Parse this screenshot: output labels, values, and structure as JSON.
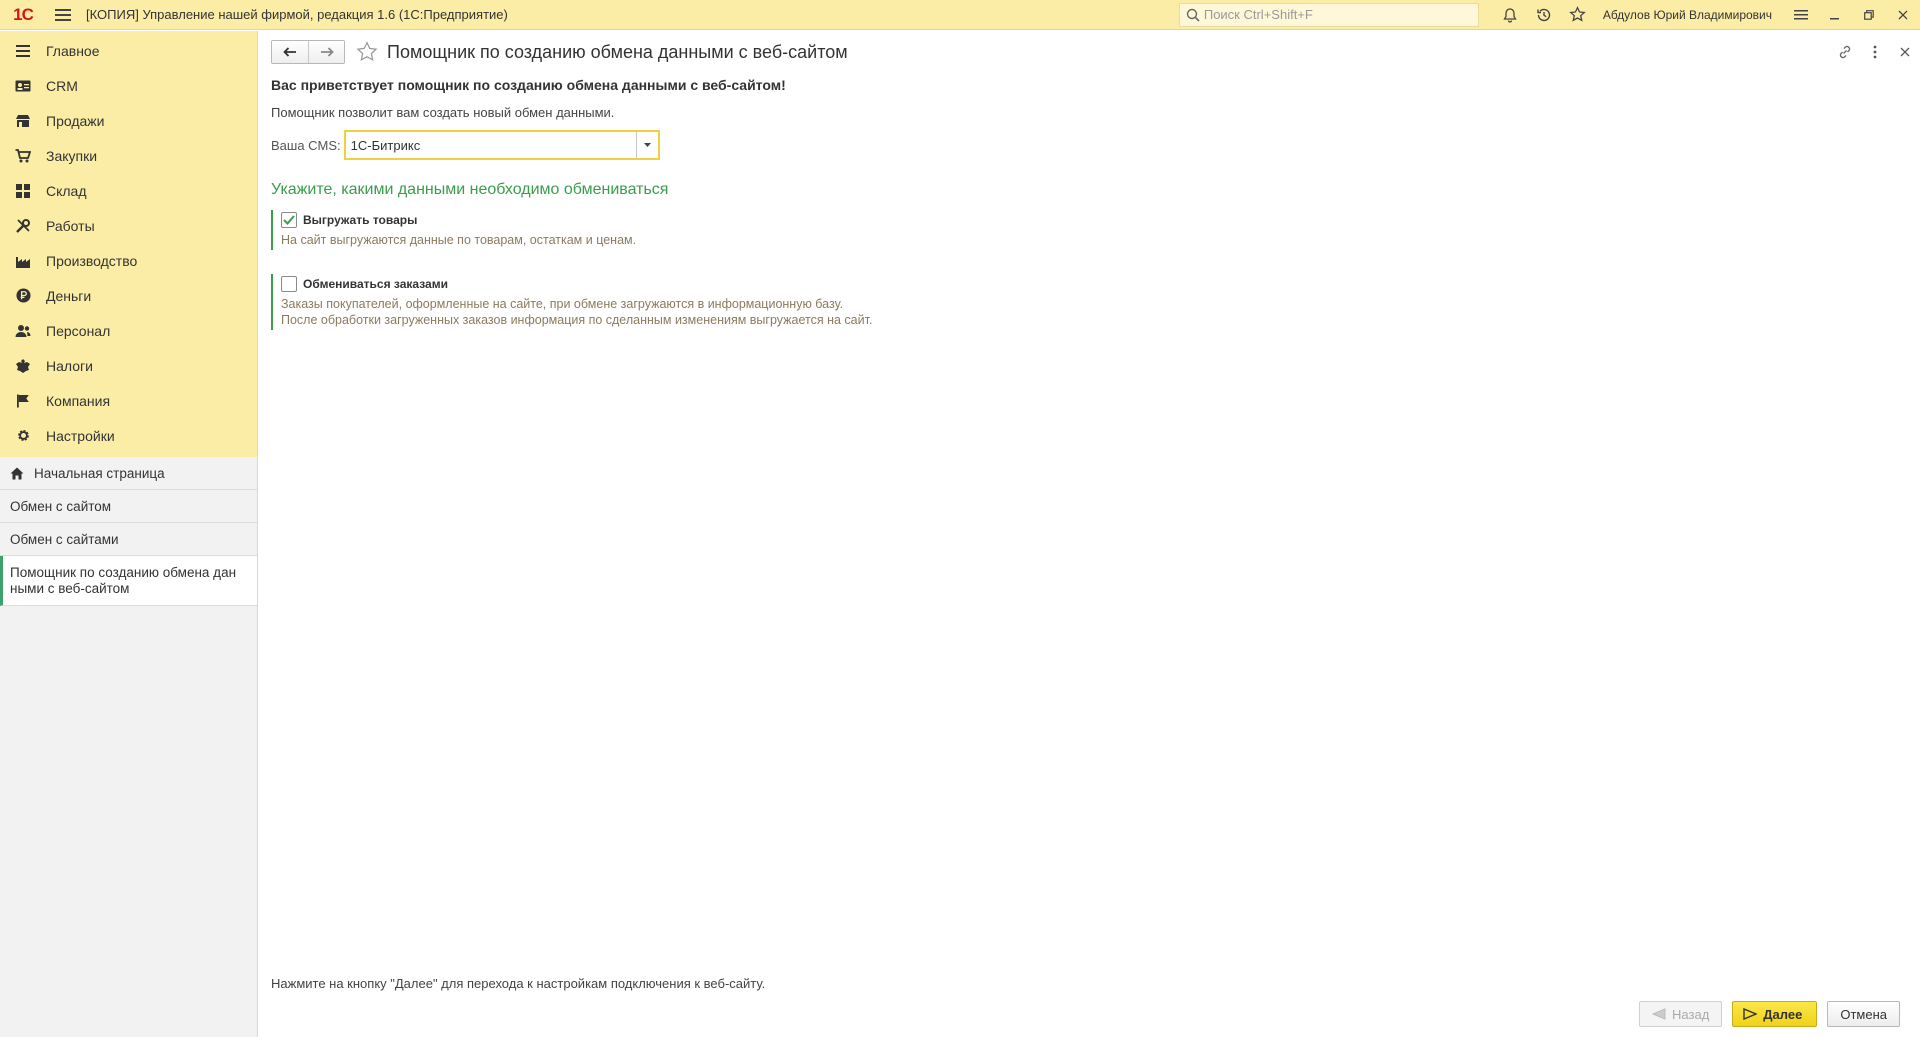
{
  "titlebar": {
    "logo": "1С",
    "title": "[КОПИЯ] Управление нашей фирмой, редакция 1.6  (1С:Предприятие)",
    "search_placeholder": "Поиск Ctrl+Shift+F",
    "user": "Абдулов Юрий Владимирович"
  },
  "sidebar": {
    "sections": [
      {
        "label": "Главное",
        "icon": "list-icon"
      },
      {
        "label": "CRM",
        "icon": "contacts-icon"
      },
      {
        "label": "Продажи",
        "icon": "shop-icon"
      },
      {
        "label": "Закупки",
        "icon": "cart-icon"
      },
      {
        "label": "Склад",
        "icon": "warehouse-icon"
      },
      {
        "label": "Работы",
        "icon": "tools-icon"
      },
      {
        "label": "Производство",
        "icon": "factory-icon"
      },
      {
        "label": "Деньги",
        "icon": "ruble-icon"
      },
      {
        "label": "Персонал",
        "icon": "people-icon"
      },
      {
        "label": "Налоги",
        "icon": "emblem-icon"
      },
      {
        "label": "Компания",
        "icon": "flag-icon"
      },
      {
        "label": "Настройки",
        "icon": "gear-icon"
      }
    ],
    "open_windows": {
      "home": "Начальная страница",
      "items": [
        "Обмен с сайтом",
        "Обмен с сайтами"
      ],
      "active_line1": "Помощник по созданию обмена дан",
      "active_line2": "ными с веб-сайтом"
    }
  },
  "main": {
    "title": "Помощник по созданию обмена данными с веб-сайтом",
    "welcome": "Вас приветствует помощник по созданию обмена данными с веб-сайтом!",
    "intro": "Помощник позволит вам создать новый обмен данными.",
    "cms_label": "Ваша CMS:",
    "cms_value": "1С-Битрикс",
    "section_heading": "Укажите, какими данными необходимо обмениваться",
    "options": [
      {
        "label": "Выгружать товары",
        "checked": true,
        "desc": [
          "На сайт выгружаются данные по товарам, остаткам и ценам."
        ]
      },
      {
        "label": "Обмениваться заказами",
        "checked": false,
        "desc": [
          "Заказы покупателей, оформленные на сайте, при обмене загружаются в информационную базу.",
          "После обработки загруженных заказов информация по сделанным изменениям выгружается на сайт."
        ]
      }
    ],
    "footer_note": "Нажмите на кнопку \"Далее\" для перехода к настройкам подключения к веб-сайту.",
    "buttons": {
      "back": "Назад",
      "next": "Далее",
      "cancel": "Отмена"
    }
  },
  "colors": {
    "accent_yellow": "#fbeda6",
    "green": "#3a9d4c",
    "desc": "#8b7b5e"
  }
}
